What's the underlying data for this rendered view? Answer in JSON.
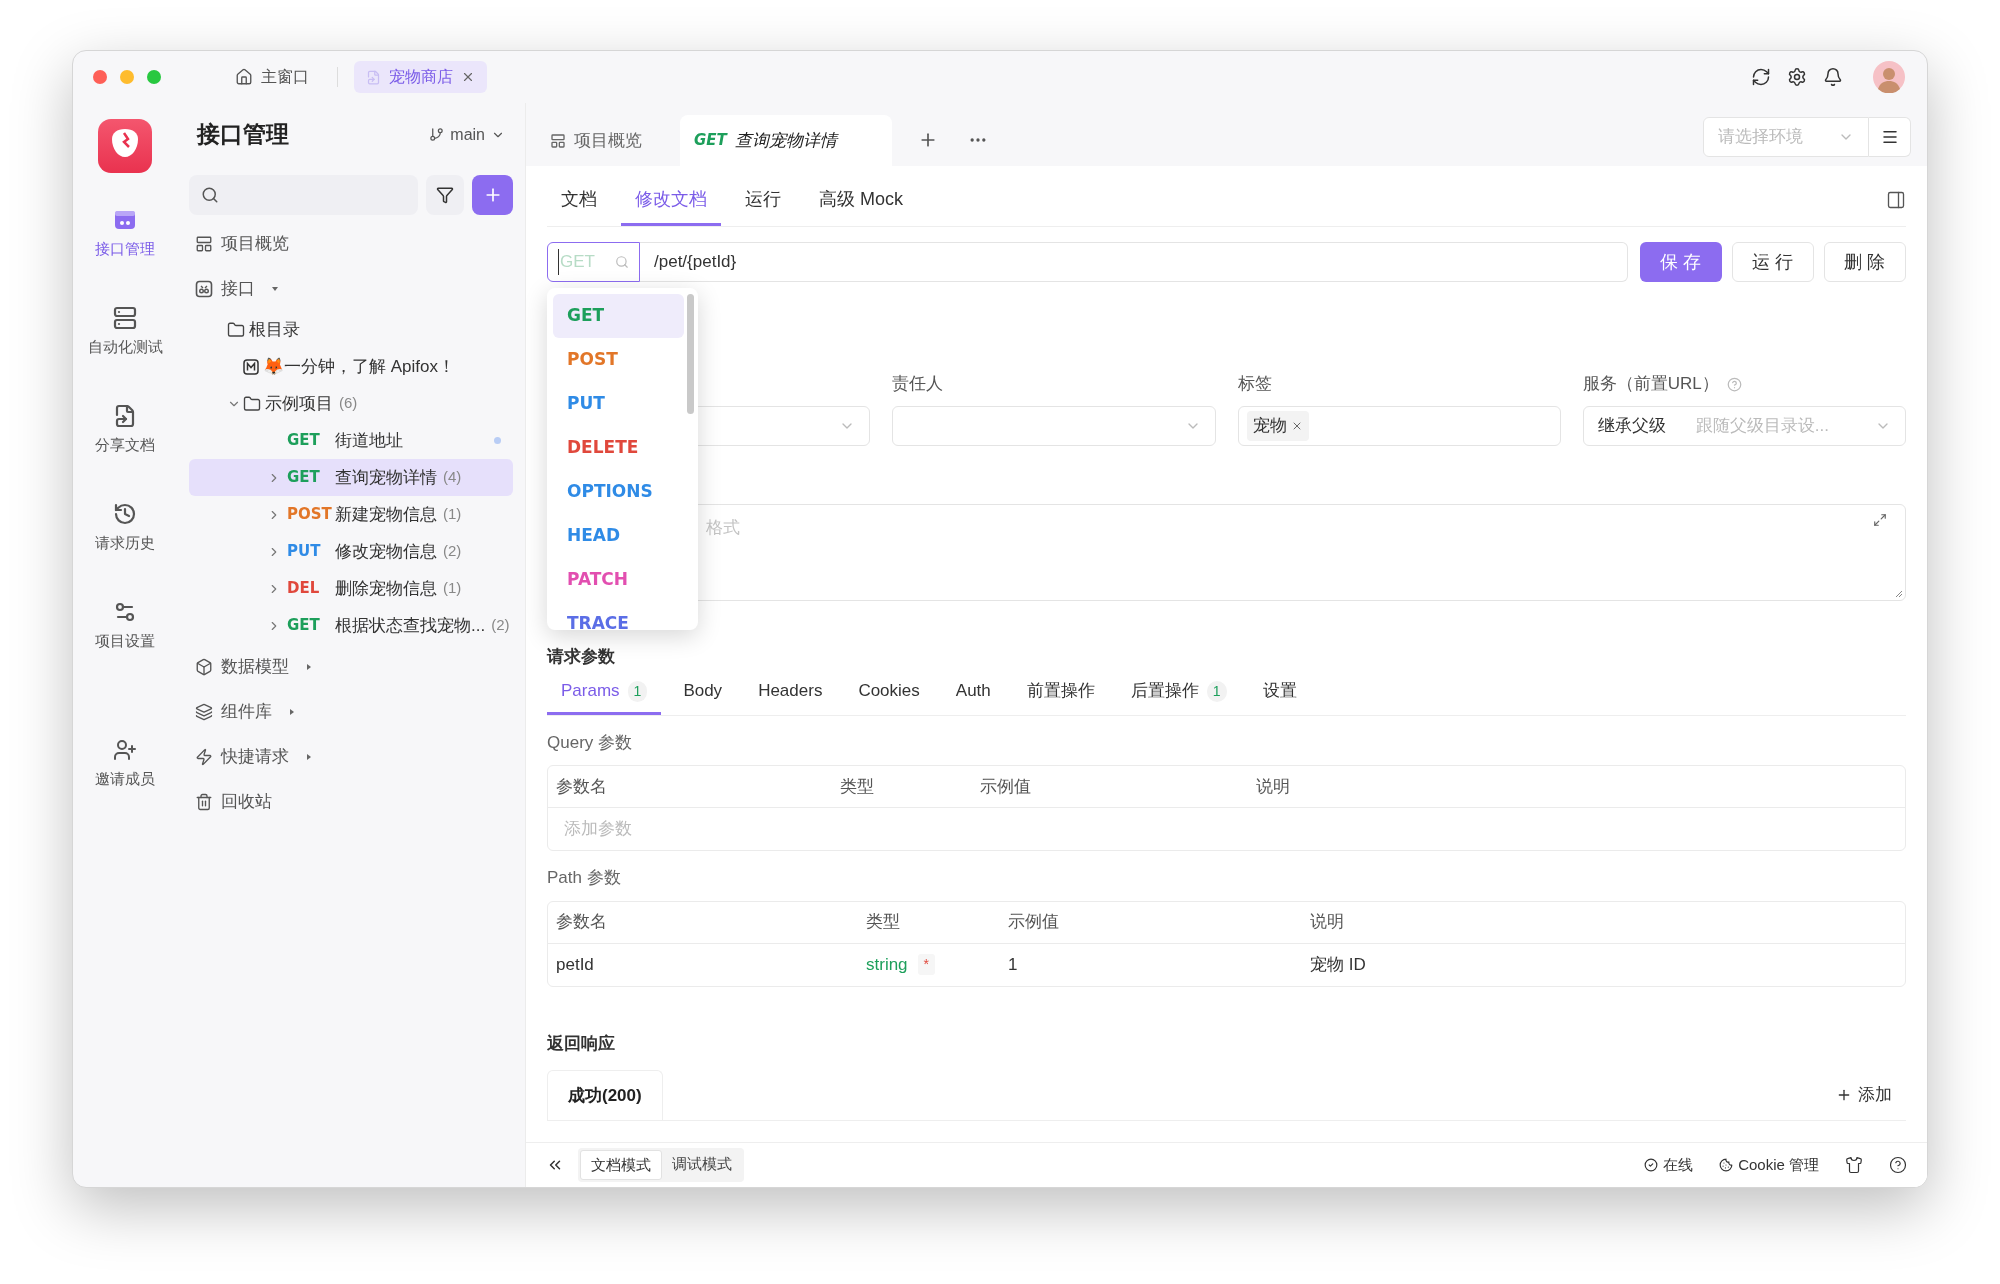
{
  "window": {
    "tabs": [
      {
        "label": "主窗口",
        "selected": false
      },
      {
        "label": "宠物商店",
        "selected": true
      }
    ]
  },
  "rail": [
    {
      "label": "接口管理",
      "selected": true
    },
    {
      "label": "自动化测试",
      "selected": false
    },
    {
      "label": "分享文档",
      "selected": false
    },
    {
      "label": "请求历史",
      "selected": false
    },
    {
      "label": "项目设置",
      "selected": false
    },
    {
      "label": "邀请成员",
      "selected": false
    }
  ],
  "sidebar": {
    "title": "接口管理",
    "branch": "main",
    "tree": [
      {
        "label": "项目概览",
        "selected": false
      },
      {
        "label": "接口",
        "selected": false,
        "expanded": true,
        "children": [
          {
            "label": "根目录",
            "selected": false,
            "children": [
              {
                "label": "🦊一分钟，了解 Apifox！",
                "selected": false,
                "kind": "doc"
              },
              {
                "label": "示例项目",
                "count": "(6)",
                "selected": false,
                "expanded": true,
                "children": [
                  {
                    "method": "GET",
                    "color": "#1d9f5b",
                    "label": "街道地址",
                    "selected": false,
                    "modified": true
                  },
                  {
                    "method": "GET",
                    "color": "#1d9f5b",
                    "label": "查询宠物详情",
                    "count": "(4)",
                    "selected": true,
                    "expanded": false
                  },
                  {
                    "method": "POST",
                    "color": "#e27628",
                    "label": "新建宠物信息",
                    "count": "(1)",
                    "selected": false,
                    "expanded": false
                  },
                  {
                    "method": "PUT",
                    "color": "#2f8be6",
                    "label": "修改宠物信息",
                    "count": "(2)",
                    "selected": false,
                    "expanded": false
                  },
                  {
                    "method": "DEL",
                    "color": "#e0483c",
                    "label": "删除宠物信息",
                    "count": "(1)",
                    "selected": false,
                    "expanded": false
                  },
                  {
                    "method": "GET",
                    "color": "#1d9f5b",
                    "label": "根据状态查找宠物...",
                    "count": "(2)",
                    "selected": false,
                    "expanded": false
                  }
                ]
              }
            ]
          }
        ]
      },
      {
        "label": "数据模型",
        "selected": false,
        "expanded": false
      },
      {
        "label": "组件库",
        "selected": false,
        "expanded": false
      },
      {
        "label": "快捷请求",
        "selected": false,
        "expanded": false
      },
      {
        "label": "回收站",
        "selected": false
      }
    ]
  },
  "doc_tabs": [
    {
      "label": "项目概览",
      "selected": false
    },
    {
      "method": "GET",
      "color": "#1d9f5b",
      "label": "查询宠物详情",
      "selected": true
    }
  ],
  "environment": {
    "placeholder": "请选择环境"
  },
  "sub_tabs": [
    {
      "label": "文档",
      "selected": false
    },
    {
      "label": "修改文档",
      "selected": true
    },
    {
      "label": "运行",
      "selected": false
    },
    {
      "label": "高级 Mock",
      "selected": false
    }
  ],
  "request": {
    "method_placeholder": "GET",
    "url": "/pet/{petId}",
    "buttons": [
      {
        "label": "保 存",
        "kind": "primary"
      },
      {
        "label": "运 行",
        "kind": "default"
      },
      {
        "label": "删 除",
        "kind": "default"
      }
    ]
  },
  "method_menu": [
    {
      "label": "GET",
      "color": "#1d9f5b",
      "selected": true
    },
    {
      "label": "POST",
      "color": "#e27628",
      "selected": false
    },
    {
      "label": "PUT",
      "color": "#2f8be6",
      "selected": false
    },
    {
      "label": "DELETE",
      "color": "#e0483c",
      "selected": false
    },
    {
      "label": "OPTIONS",
      "color": "#2f8be6",
      "selected": false
    },
    {
      "label": "HEAD",
      "color": "#2f8be6",
      "selected": false
    },
    {
      "label": "PATCH",
      "color": "#e24fb0",
      "selected": false
    },
    {
      "label": "TRACE",
      "color": "#5b6ee6",
      "selected": false
    }
  ],
  "fields": [
    {
      "kind": "select"
    },
    {
      "kind": "select",
      "label": "责任人"
    },
    {
      "kind": "tags",
      "label": "标签",
      "tags": [
        "宠物"
      ]
    },
    {
      "kind": "select",
      "label": "服务（前置URL）",
      "help": true,
      "value": "继承父级",
      "placeholder": "跟随父级目录设..."
    }
  ],
  "description": {
    "placeholder": "格式"
  },
  "params": {
    "title": "请求参数",
    "tabs": [
      {
        "label": "Params",
        "count": "1",
        "selected": true
      },
      {
        "label": "Body",
        "selected": false
      },
      {
        "label": "Headers",
        "selected": false
      },
      {
        "label": "Cookies",
        "selected": false
      },
      {
        "label": "Auth",
        "selected": false
      },
      {
        "label": "前置操作",
        "selected": false
      },
      {
        "label": "后置操作",
        "count": "1",
        "selected": false
      },
      {
        "label": "设置",
        "selected": false
      }
    ]
  },
  "query": {
    "title": "Query 参数",
    "columns": [
      "参数名",
      "类型",
      "示例值",
      "说明"
    ],
    "placeholder": "添加参数"
  },
  "path": {
    "title": "Path 参数",
    "columns": [
      "参数名",
      "类型",
      "示例值",
      "说明"
    ],
    "rows": [
      {
        "name": "petId",
        "type": "string",
        "required": "*",
        "example": "1",
        "description": "宠物 ID"
      }
    ]
  },
  "response": {
    "title": "返回响应",
    "tabs": [
      {
        "label": "成功(200)",
        "selected": true
      }
    ],
    "add": "添加"
  },
  "status_bar": {
    "modes": [
      {
        "label": "文档模式",
        "selected": true
      },
      {
        "label": "调试模式",
        "selected": false
      }
    ],
    "items": [
      "在线",
      "Cookie 管理"
    ]
  }
}
